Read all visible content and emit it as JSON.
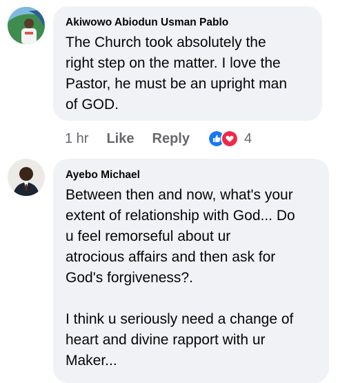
{
  "comments": [
    {
      "author": "Akiwowo Abiodun Usman Pablo",
      "text": "The Church took absolutely the\nright step on the matter. I love the\nPastor, he must be an upright man\nof GOD.",
      "time": "1 hr",
      "like_label": "Like",
      "reply_label": "Reply",
      "reaction_count": "4",
      "reactions": [
        "like-icon",
        "love-icon"
      ]
    },
    {
      "author": "Ayebo Michael",
      "text": "Between then and now, what's your\nextent of relationship with God... Do\nu feel remorseful about ur\natrocious affairs and then ask for\nGod's forgiveness?.\n\nI think u seriously need a change of\nheart and divine rapport with ur\nMaker..."
    }
  ],
  "colors": {
    "bubble": "#f0f2f5",
    "meta_text": "#65676b",
    "like_blue": "#1877f2",
    "love_red": "#f02849"
  }
}
